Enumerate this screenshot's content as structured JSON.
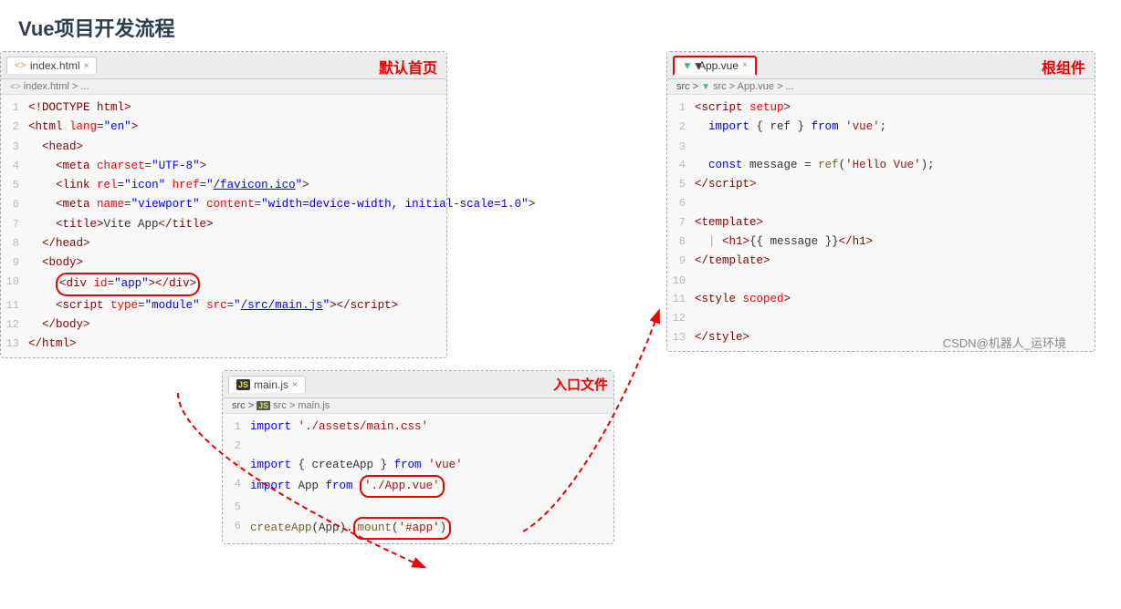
{
  "title": "Vue项目开发流程",
  "panels": {
    "index": {
      "tab_label": "index.html",
      "tab_icon": "html",
      "panel_label": "默认首页",
      "breadcrumb": "index.html > ...",
      "lines": [
        {
          "num": 1,
          "content": "<!DOCTYPE html>"
        },
        {
          "num": 2,
          "content": "<html lang=\"en\">"
        },
        {
          "num": 3,
          "content": "<head>"
        },
        {
          "num": 4,
          "content": "  <meta charset=\"UTF-8\">"
        },
        {
          "num": 5,
          "content": "  <link rel=\"icon\" href=\"/favicon.ico\">"
        },
        {
          "num": 6,
          "content": "  <meta name=\"viewport\" content=\"width=device-width, initial-scale=1.0\">"
        },
        {
          "num": 7,
          "content": "  <title>Vite App</title>"
        },
        {
          "num": 8,
          "content": "</head>"
        },
        {
          "num": 9,
          "content": "<body>"
        },
        {
          "num": 10,
          "content": "  <div id=\"app\"></div>",
          "highlight": "div"
        },
        {
          "num": 11,
          "content": "  <script type=\"module\" src=\"/src/main.js\"></script>"
        },
        {
          "num": 12,
          "content": "</body>"
        },
        {
          "num": 13,
          "content": "</html>"
        }
      ]
    },
    "main": {
      "tab_label": "main.js",
      "tab_icon": "js",
      "panel_label": "入口文件",
      "breadcrumb": "src > main.js",
      "lines": [
        {
          "num": 1,
          "content": "import './assets/main.css'"
        },
        {
          "num": 2,
          "content": ""
        },
        {
          "num": 3,
          "content": "import { createApp } from 'vue'"
        },
        {
          "num": 4,
          "content": "import App from './App.vue'",
          "highlight": "AppVue"
        },
        {
          "num": 5,
          "content": ""
        },
        {
          "num": 6,
          "content": "createApp(App).mount('#app')",
          "highlight": "mount"
        }
      ]
    },
    "app": {
      "tab_label": "App.vue",
      "tab_icon": "vue",
      "panel_label": "根组件",
      "breadcrumb": "src > App.vue > ...",
      "lines": [
        {
          "num": 1,
          "content": "<script setup>"
        },
        {
          "num": 2,
          "content": "  import { ref } from 'vue';"
        },
        {
          "num": 3,
          "content": ""
        },
        {
          "num": 4,
          "content": "  const message = ref('Hello Vue');"
        },
        {
          "num": 5,
          "content": "</script>"
        },
        {
          "num": 6,
          "content": ""
        },
        {
          "num": 7,
          "content": "<template>"
        },
        {
          "num": 8,
          "content": "  | <h1>{{ message }}</h1>"
        },
        {
          "num": 9,
          "content": "</template>"
        },
        {
          "num": 10,
          "content": ""
        },
        {
          "num": 11,
          "content": "<style scoped>"
        },
        {
          "num": 12,
          "content": ""
        },
        {
          "num": 13,
          "content": "</style>"
        }
      ]
    }
  },
  "watermark": "CSDN@机器人_运环境",
  "arrows": {
    "desc1": "dashed red arrow from index div#app to main.js mount('#app')",
    "desc2": "dashed red arrow from main.js import App.vue to App.vue panel"
  }
}
